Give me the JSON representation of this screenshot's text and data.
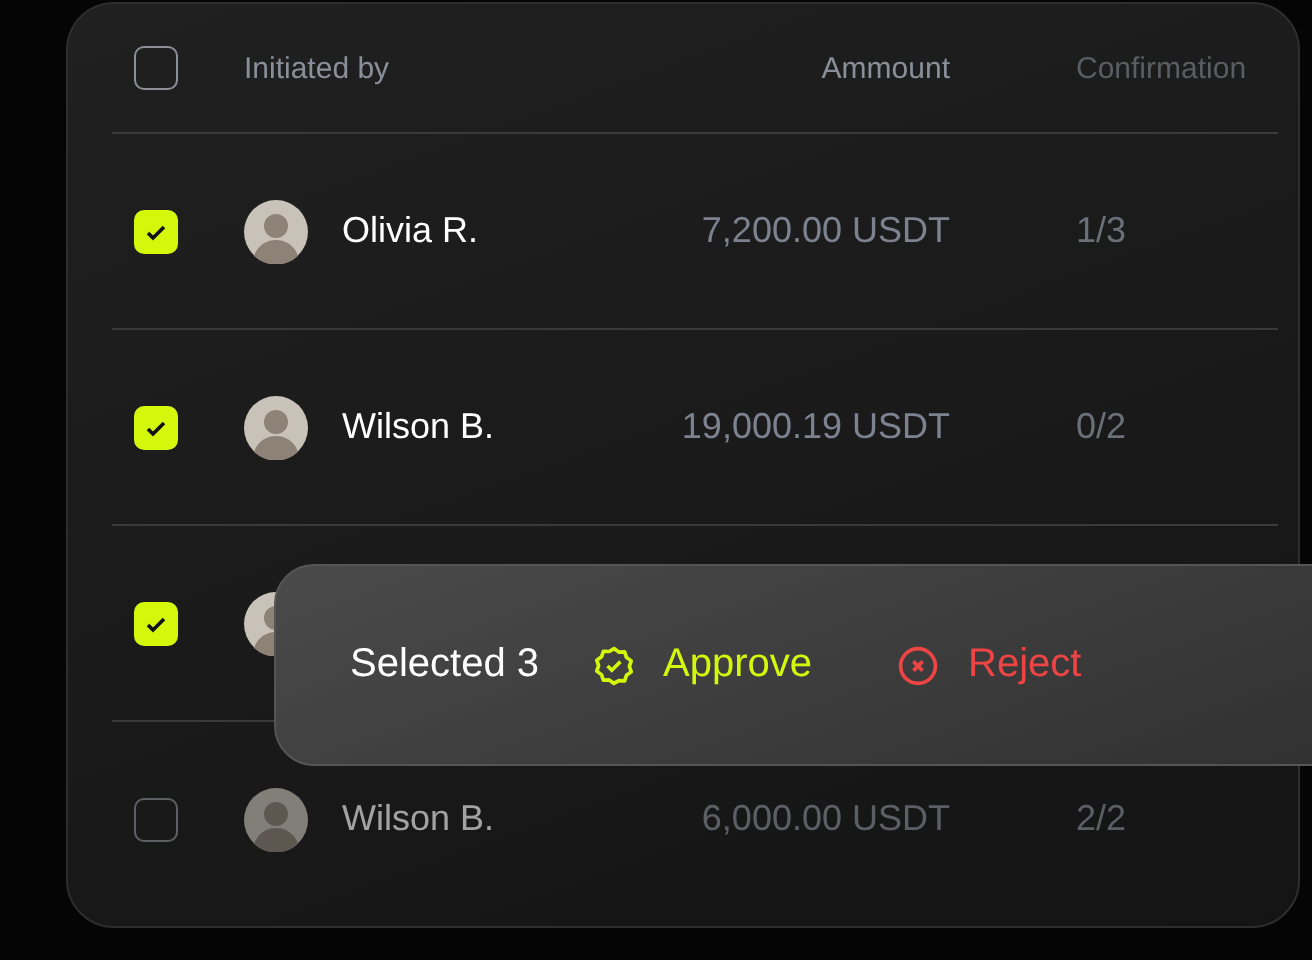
{
  "table": {
    "select_all": {
      "checked": false
    },
    "columns": [
      "Initiated by",
      "Ammount",
      "Confirmation"
    ],
    "rows": [
      {
        "checked": true,
        "name": "Olivia R.",
        "amount": "7,200.00 USDT",
        "confirmations": "1/3"
      },
      {
        "checked": true,
        "name": "Wilson B.",
        "amount": "19,000.19 USDT",
        "confirmations": "0/2"
      },
      {
        "checked": true
      },
      {
        "checked": false,
        "name": "Wilson B.",
        "amount": "6,000.00 USDT",
        "confirmations": "2/2"
      }
    ]
  },
  "selection_bar": {
    "count_label": "Selected 3",
    "actions": [
      {
        "kind": "approve",
        "label": "Approve"
      },
      {
        "kind": "reject",
        "label": "Reject"
      }
    ]
  }
}
